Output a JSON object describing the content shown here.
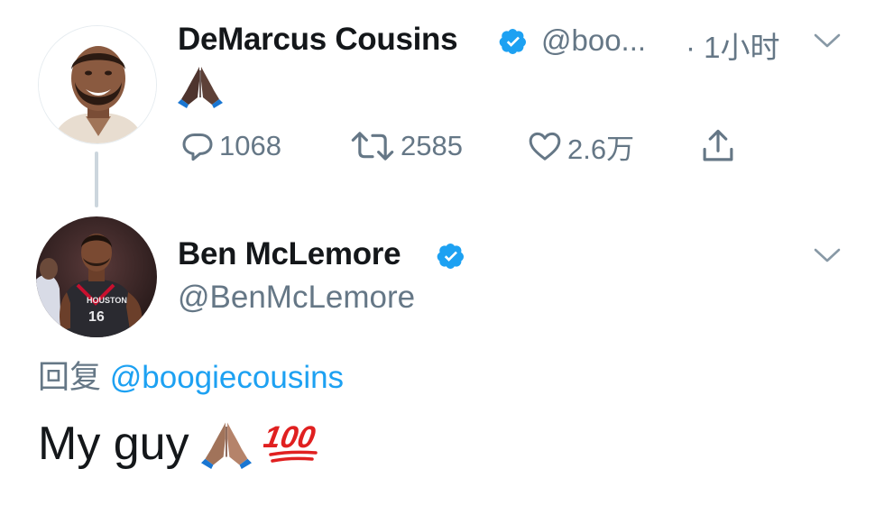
{
  "tweet": {
    "author": {
      "name": "DeMarcus Cousins",
      "handle": "@boo...",
      "verified": true
    },
    "time": "· 1小时",
    "content_emoji": "folded-hands-dark",
    "actions": {
      "replies": "1068",
      "retweets": "2585",
      "likes": "2.6万"
    }
  },
  "reply": {
    "author": {
      "name": "Ben McLemore",
      "handle": "@BenMcLemore",
      "verified": true
    },
    "reply_prefix": "回复",
    "reply_to": "@boogiecousins",
    "text": "My guy",
    "emojis": [
      "folded-hands-medium",
      "hundred-points"
    ]
  },
  "colors": {
    "accent": "#1da1f2",
    "secondary_text": "#657786",
    "primary_text": "#14171a",
    "thread_line": "#ccd6dd"
  },
  "icons": [
    "verified-badge-icon",
    "chevron-down-icon",
    "reply-icon",
    "retweet-icon",
    "like-icon",
    "share-icon"
  ]
}
